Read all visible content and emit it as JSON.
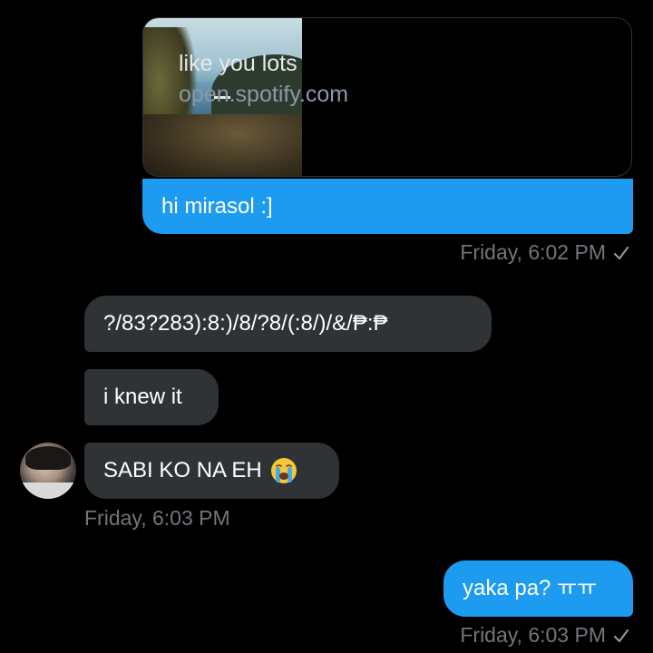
{
  "link_preview": {
    "title": "like you lots",
    "domain": "open.spotify.com"
  },
  "messages": [
    {
      "side": "sent",
      "text": "hi mirasol :]"
    },
    {
      "side": "received",
      "text": "?/83?283):8:)/8/?8/(:8/)/&/₱:₱"
    },
    {
      "side": "received",
      "text": "i knew it"
    },
    {
      "side": "received",
      "text": "SABI KO NA EH",
      "emoji": "loudly-crying-face-icon"
    },
    {
      "side": "sent",
      "text": "yaka pa? ㅠㅠ"
    }
  ],
  "timestamps": {
    "first": "Friday, 6:02 PM",
    "received": "Friday, 6:03 PM",
    "last": "Friday, 6:03 PM"
  },
  "colors": {
    "background": "#000000",
    "sent_bubble": "#1d9bf0",
    "received_bubble": "#2f3336",
    "timestamp": "#71767b"
  }
}
